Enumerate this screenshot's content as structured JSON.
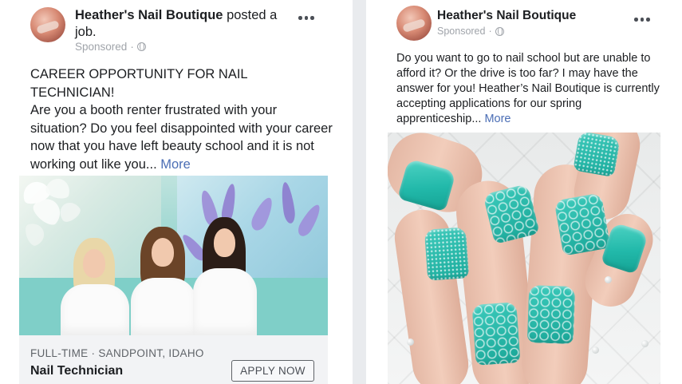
{
  "left_post": {
    "page_name": "Heather's Nail Boutique",
    "action": "posted a job.",
    "sponsored": "Sponsored",
    "body": "CAREER OPPORTUNITY FOR NAIL TECHNICIAN!\nAre you a booth renter frustrated with your situation? Do you feel disappointed with your career now that you have left beauty school and it is not working out like you...",
    "see_more": "More",
    "job": {
      "meta": "FULL-TIME · SANDPOINT, IDAHO",
      "title": "Nail Technician",
      "apply_label": "APPLY NOW"
    }
  },
  "right_post": {
    "page_name": "Heather's Nail Boutique",
    "sponsored": "Sponsored",
    "body": "Do you want to go to nail school but are unable to afford it? Or the drive is too far? I may have the answer for you! Heather’s Nail Boutique is currently accepting applications for our spring apprenticeship...",
    "see_more": "More"
  },
  "icons": {
    "globe": "globe-icon",
    "more": "more-options-icon",
    "avatar": "page-avatar"
  },
  "colors": {
    "link": "#4b6eb5",
    "muted": "#a0a4aa",
    "teal_accent": "#22b9aa"
  }
}
